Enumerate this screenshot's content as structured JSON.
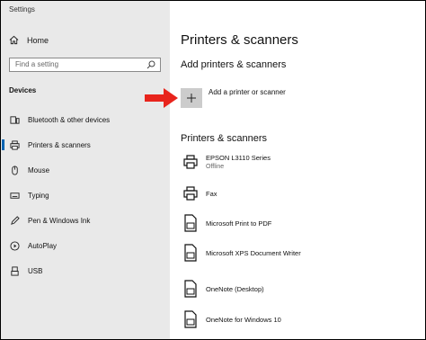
{
  "window": {
    "title": "Settings"
  },
  "sidebar": {
    "home_label": "Home",
    "search_placeholder": "Find a setting",
    "section_label": "Devices",
    "items": [
      {
        "label": "Bluetooth & other devices",
        "icon": "bluetooth-devices-icon"
      },
      {
        "label": "Printers & scanners",
        "icon": "printer-icon",
        "active": true
      },
      {
        "label": "Mouse",
        "icon": "mouse-icon"
      },
      {
        "label": "Typing",
        "icon": "keyboard-icon"
      },
      {
        "label": "Pen & Windows Ink",
        "icon": "pen-icon"
      },
      {
        "label": "AutoPlay",
        "icon": "autoplay-icon"
      },
      {
        "label": "USB",
        "icon": "usb-icon"
      }
    ],
    "accent_color": "#0063b1"
  },
  "main": {
    "page_title": "Printers & scanners",
    "add_section_title": "Add printers & scanners",
    "add_button_label": "Add a printer or scanner",
    "list_section_title": "Printers & scanners",
    "devices": [
      {
        "name": "EPSON L3110 Series",
        "status": "Offline",
        "icon": "printer-icon"
      },
      {
        "name": "Fax",
        "status": "",
        "icon": "fax-icon"
      },
      {
        "name": "Microsoft Print to PDF",
        "status": "",
        "icon": "document-printer-icon"
      },
      {
        "name": "Microsoft XPS Document Writer",
        "status": "",
        "icon": "document-printer-icon"
      },
      {
        "name": "OneNote (Desktop)",
        "status": "",
        "icon": "document-printer-icon"
      },
      {
        "name": "OneNote for Windows 10",
        "status": "",
        "icon": "document-printer-icon"
      }
    ]
  },
  "annotation": {
    "arrow_color": "#e8241c"
  }
}
